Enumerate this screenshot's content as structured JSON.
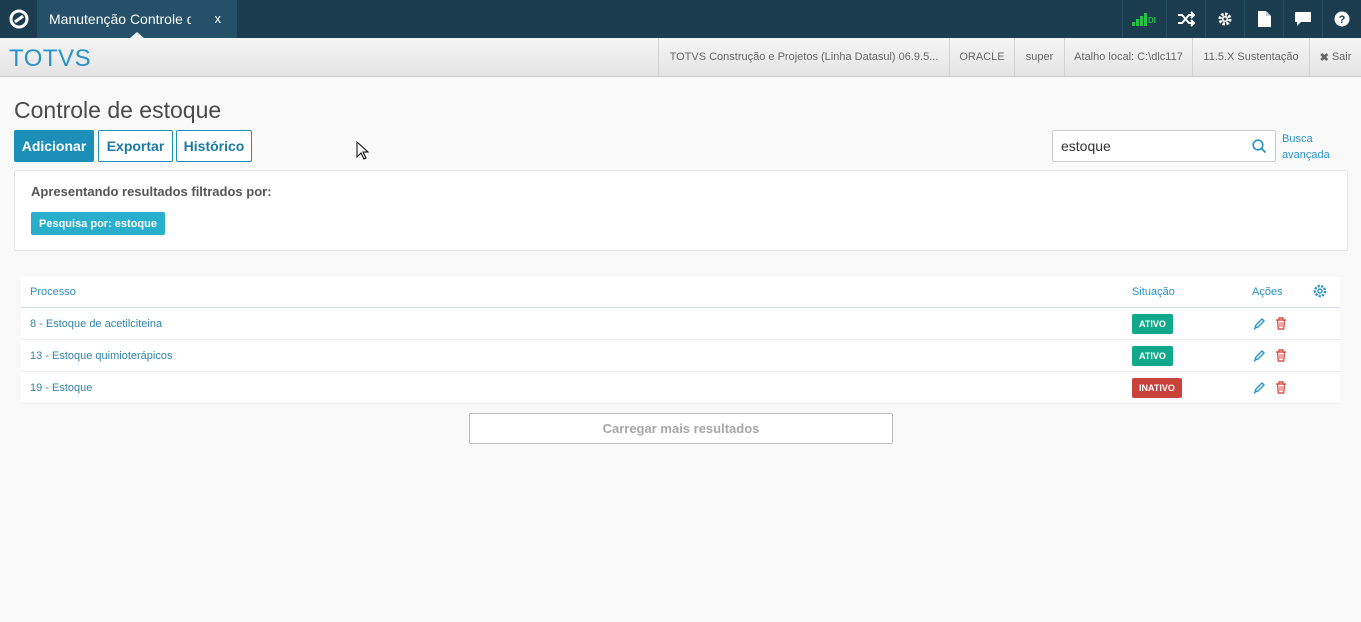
{
  "tab": {
    "label": "Manutenção Controle de Estoque",
    "close": "x"
  },
  "topbar_icons": {
    "signal_label": "DI"
  },
  "header": {
    "brand": "TOTVS",
    "product": "TOTVS Construção e Projetos (Linha Datasul) 06.9.5...",
    "database": "ORACLE",
    "user": "super",
    "shortcut": "Atalho local: C:\\dlc117",
    "version": "11.5.X Sustentação",
    "logout": "Sair"
  },
  "page": {
    "title": "Controle de estoque"
  },
  "toolbar": {
    "add": "Adicionar",
    "export": "Exportar",
    "history": "Histórico"
  },
  "search": {
    "value": "estoque",
    "advanced_line1": "Busca",
    "advanced_line2": "avançada"
  },
  "filter": {
    "title": "Apresentando resultados filtrados por:",
    "chip": "Pesquisa por: estoque"
  },
  "table": {
    "headers": {
      "process": "Processo",
      "status": "Situação",
      "actions": "Ações"
    },
    "rows": [
      {
        "process": "8 - Estoque de acetilciteina",
        "status": "ATIVO",
        "status_color": "#12a88b"
      },
      {
        "process": "13 - Estoque quimioterápicos",
        "status": "ATIVO",
        "status_color": "#12a88b"
      },
      {
        "process": "19 - Estoque",
        "status": "INATIVO",
        "status_color": "#c9413a"
      }
    ]
  },
  "load_more": "Carregar mais resultados",
  "colors": {
    "topbar": "#1b3d4f",
    "accent": "#2a93c6",
    "primary_button": "#1b8fb8",
    "chip": "#29aecc"
  }
}
